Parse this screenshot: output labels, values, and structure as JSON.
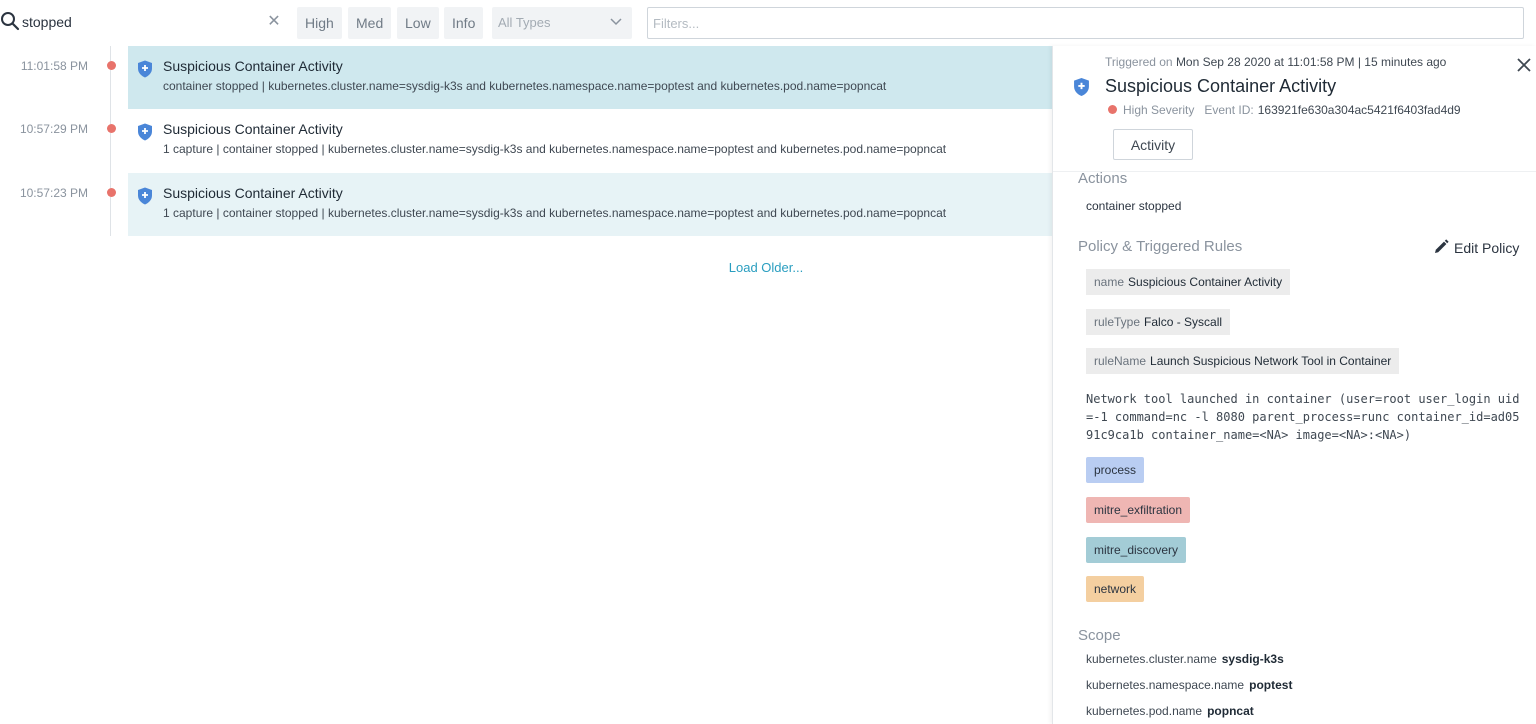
{
  "search": {
    "value": "stopped"
  },
  "severity_buttons": [
    "High",
    "Med",
    "Low",
    "Info"
  ],
  "type_select": {
    "selected": "All Types"
  },
  "filters": {
    "placeholder": "Filters..."
  },
  "events": [
    {
      "time": "11:01:58 PM",
      "title": "Suspicious Container Activity",
      "description": "container stopped | kubernetes.cluster.name=sysdig-k3s and kubernetes.namespace.name=poptest and kubernetes.pod.name=popncat"
    },
    {
      "time": "10:57:29 PM",
      "title": "Suspicious Container Activity",
      "description": "1 capture | container stopped | kubernetes.cluster.name=sysdig-k3s and kubernetes.namespace.name=poptest and kubernetes.pod.name=popncat"
    },
    {
      "time": "10:57:23 PM",
      "title": "Suspicious Container Activity",
      "description": "1 capture | container stopped | kubernetes.cluster.name=sysdig-k3s and kubernetes.namespace.name=poptest and kubernetes.pod.name=popncat"
    }
  ],
  "load_older": "Load Older...",
  "detail": {
    "triggered_label": "Triggered on",
    "triggered_value": "Mon Sep 28 2020 at 11:01:58 PM | 15 minutes ago",
    "title": "Suspicious Container Activity",
    "severity": "High Severity",
    "event_id_label": "Event ID:",
    "event_id": "163921fe630a304ac5421f6403fad4d9",
    "tab": "Activity",
    "actions_heading": "Actions",
    "actions_value": "container stopped",
    "policy_heading": "Policy & Triggered Rules",
    "edit_policy": "Edit Policy",
    "rules": [
      {
        "key": "name",
        "value": "Suspicious Container Activity"
      },
      {
        "key": "ruleType",
        "value": "Falco - Syscall"
      },
      {
        "key": "ruleName",
        "value": "Launch Suspicious Network Tool in Container"
      }
    ],
    "output": "Network tool launched in container (user=root user_login uid=-1 command=nc -l 8080 parent_process=runc container_id=ad0591c9ca1b container_name=<NA> image=<NA>:<NA>)",
    "tags": [
      {
        "label": "process",
        "color": "#b9cdf2"
      },
      {
        "label": "mitre_exfiltration",
        "color": "#efb6b3"
      },
      {
        "label": "mitre_discovery",
        "color": "#a3ccd6"
      },
      {
        "label": "network",
        "color": "#f4cfa0"
      }
    ],
    "scope_heading": "Scope",
    "scope": [
      {
        "key": "kubernetes.cluster.name",
        "value": "sysdig-k3s"
      },
      {
        "key": "kubernetes.namespace.name",
        "value": "poptest"
      },
      {
        "key": "kubernetes.pod.name",
        "value": "popncat"
      }
    ]
  },
  "colors": {
    "accent": "#2a9ec0",
    "severity_high": "#e8736b",
    "shield": "#4a86d8",
    "selected_row": "#cfe8ee"
  }
}
